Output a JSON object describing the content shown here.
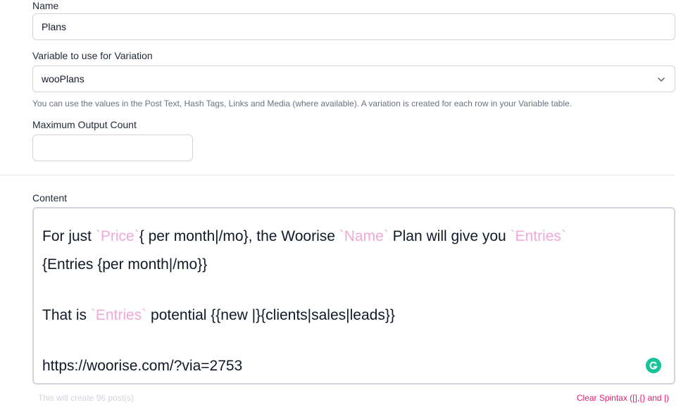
{
  "form": {
    "name_label": "Name",
    "name_value": "Plans",
    "variable_label": "Variable to use for Variation",
    "variable_value": "wooPlans",
    "variable_help": "You can use the values in the Post Text, Hash Tags, Links and Media (where available). A variation is created for each row in your Variable table.",
    "max_output_label": "Maximum Output Count",
    "max_output_value": "",
    "content_label": "Content"
  },
  "content": {
    "line1_prefix": "For just ",
    "var_price": "Price",
    "line1_mid1": "{ per month|/mo}, the Woorise ",
    "var_name": "Name",
    "line1_mid2": " Plan will give you ",
    "var_entries": "Entries",
    "line2": "{Entries {per month|/mo}}",
    "line3_prefix": "That is ",
    "var_entries2": "Entries",
    "line3_suffix": " potential {{new |}{clients|sales|leads}}",
    "line4": "https://woorise.com/?via=2753"
  },
  "footer": {
    "post_count_text": "This will create 96 post(s)",
    "clear_spintax_label": "Clear Spintax ([],{} and |)"
  },
  "colors": {
    "variable_token": "#f0a8d8",
    "link_accent": "#e11d73",
    "grammarly": "#15c39a"
  },
  "icons": {
    "select_chevron": "chevron-down-icon",
    "grammarly": "grammarly-icon"
  }
}
